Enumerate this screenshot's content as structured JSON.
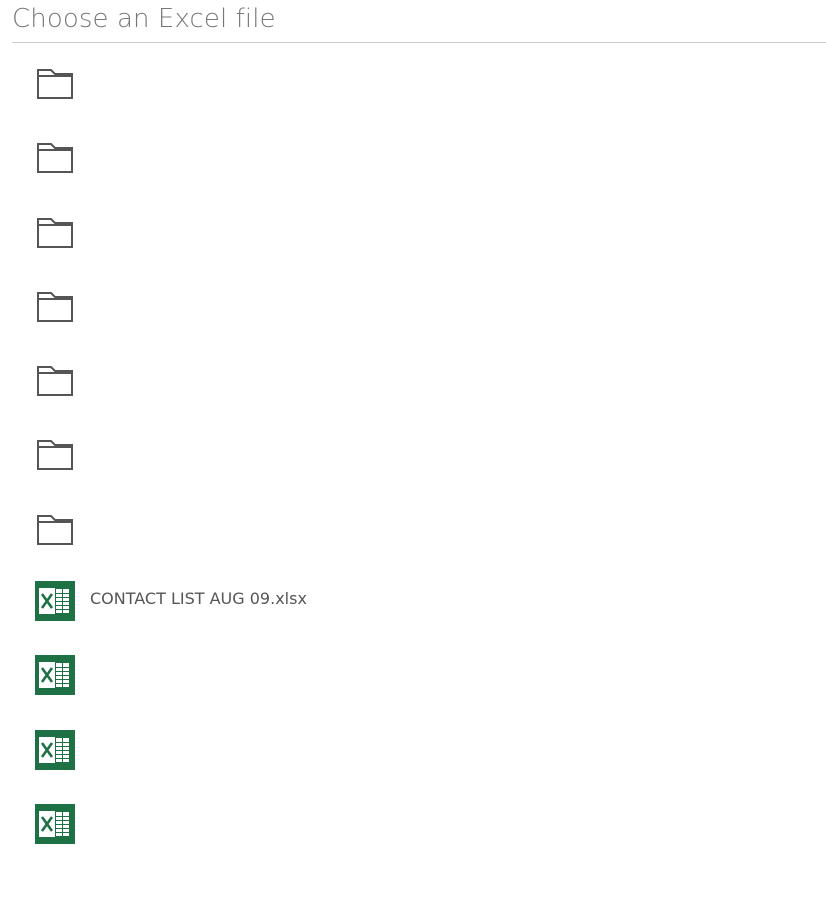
{
  "dialog": {
    "title": "Choose an Excel file"
  },
  "colors": {
    "excel_green": "#1e7145",
    "folder_outline": "#555555",
    "title_text": "#777777",
    "divider": "#cfcfcf"
  },
  "items": [
    {
      "type": "folder",
      "icon": "folder-icon",
      "name": "",
      "obscured": true
    },
    {
      "type": "folder",
      "icon": "folder-icon",
      "name": "",
      "obscured": true
    },
    {
      "type": "folder",
      "icon": "folder-icon",
      "name": "",
      "obscured": true
    },
    {
      "type": "folder",
      "icon": "folder-icon",
      "name": "",
      "obscured": true
    },
    {
      "type": "folder",
      "icon": "folder-icon",
      "name": "",
      "obscured": true
    },
    {
      "type": "folder",
      "icon": "folder-icon",
      "name": "",
      "obscured": true
    },
    {
      "type": "folder",
      "icon": "folder-icon",
      "name": "",
      "obscured": true
    },
    {
      "type": "file",
      "icon": "excel-file-icon",
      "name": "CONTACT LIST AUG 09.xlsx",
      "obscured": false
    },
    {
      "type": "file",
      "icon": "excel-file-icon",
      "name": "",
      "obscured": true
    },
    {
      "type": "file",
      "icon": "excel-file-icon",
      "name": "",
      "obscured": true
    },
    {
      "type": "file",
      "icon": "excel-file-icon",
      "name": "",
      "obscured": true
    }
  ]
}
